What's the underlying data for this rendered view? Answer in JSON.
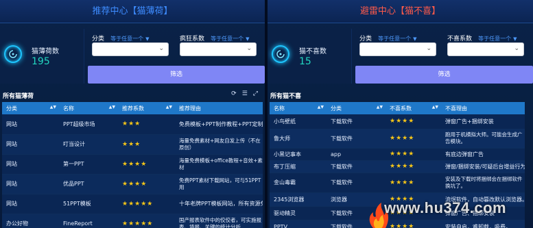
{
  "left": {
    "title": "推荐中心【猫薄荷】",
    "stat": {
      "label": "猫薄荷数",
      "value": "195"
    },
    "filters": [
      {
        "label": "分类",
        "any": "等于任意一个"
      },
      {
        "label": "疯狂系数",
        "any": "等于任意一个"
      }
    ],
    "button": "筛选",
    "list_title": "所有猫薄荷",
    "columns": [
      "分类",
      "名称",
      "推荐系数",
      "推荐理由"
    ],
    "rows": [
      {
        "cat": "网站",
        "name": "PPT超级市场",
        "stars": "★★★",
        "reason": "免费模板+PPT制作教程+PPT定制"
      },
      {
        "cat": "网站",
        "name": "叮当设计",
        "stars": "★★★",
        "reason": "海量免费素材+网友自发上传（不在原创）"
      },
      {
        "cat": "网站",
        "name": "第一PPT",
        "stars": "★★★★",
        "reason": "海量免费模板+office教程+音效+素材"
      },
      {
        "cat": "网站",
        "name": "优品PPT",
        "stars": "★★★★",
        "reason": "免费PPT素材下载网站，可与51PPT用"
      },
      {
        "cat": "网站",
        "name": "51PPT模板",
        "stars": "★★★★★",
        "reason": "十年老牌PPT模板网站，所有资源免费"
      },
      {
        "cat": "办公好物",
        "name": "FineReport",
        "stars": "★★★★★",
        "reason": "国产报表软件中的佼佼者，可实施报表、填报、关键的统计分析"
      }
    ]
  },
  "right": {
    "title": "避雷中心【猫不喜】",
    "stat": {
      "label": "猫不喜数",
      "value": "15"
    },
    "filters": [
      {
        "label": "分类",
        "any": "等于任意一个"
      },
      {
        "label": "不喜系数",
        "any": "等于任意一个"
      }
    ],
    "button": "筛选",
    "list_title": "所有猫不喜",
    "columns": [
      "名称",
      "分类",
      "不喜系数",
      "不喜理由"
    ],
    "rows": [
      {
        "name": "小鸟壁纸",
        "cat": "下载软件",
        "stars": "★★★★",
        "reason": "弹窗广告+捆绑安装"
      },
      {
        "name": "鲁大师",
        "cat": "下载软件",
        "stars": "★★★★",
        "reason": "跑用于机横拟大师。可能会生成广告模块。"
      },
      {
        "name": "小黑记事本",
        "cat": "app",
        "stars": "★★★★",
        "reason": "有底边弹窗广告"
      },
      {
        "name": "布丁压缩",
        "cat": "下载软件",
        "stars": "★★★★",
        "reason": "弹窗/捆绑安装/可疑后台增益行为"
      },
      {
        "name": "金山毒霸",
        "cat": "下载软件",
        "stars": "★★★★",
        "reason": "安装及下载时将捆绑会在捆绑软件换坑了。"
      },
      {
        "name": "2345浏览器",
        "cat": "浏览器",
        "stars": "★★★★",
        "reason": "流氓软件，自动篡改默认浏览器。"
      },
      {
        "name": "驱动精灵",
        "cat": "下载软件",
        "stars": "★★★★",
        "reason": "弹窗广告、捆绑安装"
      },
      {
        "name": "PPTV",
        "cat": "下载软件",
        "stars": "★★★★",
        "reason": "安装自启，难卸载，吸费。"
      }
    ]
  },
  "watermark": {
    "text": "www.hu374.com"
  },
  "icons": {
    "stat": "radar-icon",
    "refresh": "refresh-icon",
    "columns": "column-settings-icon",
    "expand": "expand-icon",
    "sort": "sort-icon",
    "chevron": "chevron-down-icon"
  },
  "colors": {
    "accent": "#7f86f5",
    "header": "#1f78c9",
    "star": "#f5c518",
    "left_title": "#3e8cff",
    "right_title": "#ff5a4a",
    "stat_value": "#22d7c0"
  }
}
